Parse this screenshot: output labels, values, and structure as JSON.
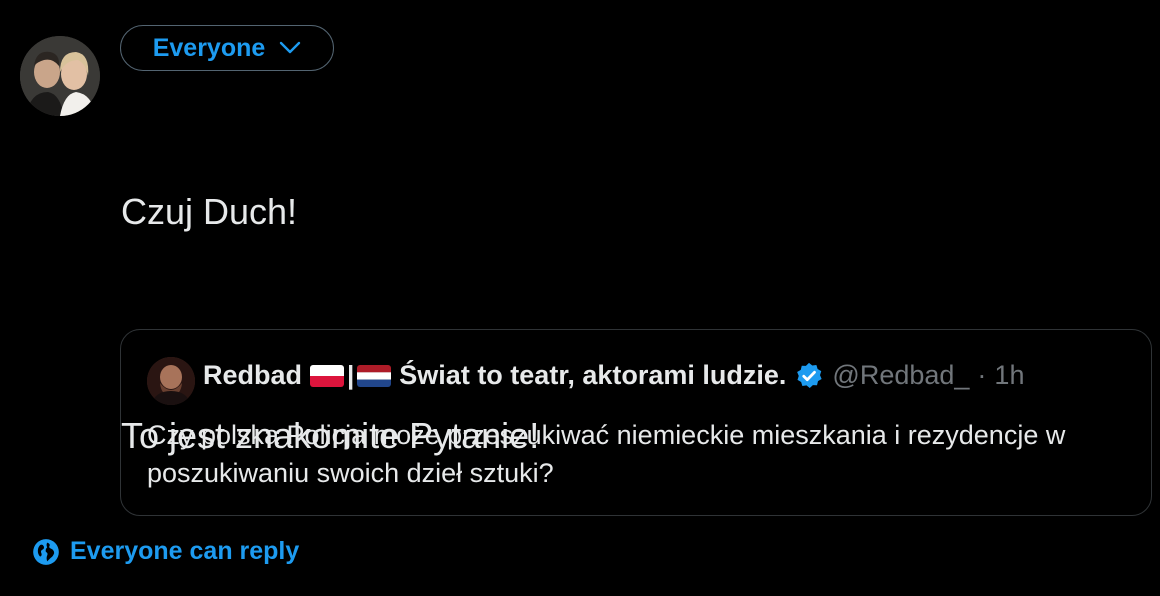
{
  "composer": {
    "audience_label": "Everyone",
    "text_line1": "Czuj Duch!",
    "text_line2": "To jest znakomite Pytanie!"
  },
  "quoted_tweet": {
    "author_name": "Redbad",
    "author_tagline": "Świat to teatr, aktorami ludzie.",
    "handle": "@Redbad_",
    "separator": "·",
    "time": "1h",
    "body": "Czy polska Policja może przeszukiwać niemieckie mieszkania i rezydencje w poszukiwaniu swoich dzieł sztuki?",
    "flags": [
      "poland-flag",
      "netherlands-flag"
    ],
    "flag_separator": "|"
  },
  "reply_settings": {
    "label": "Everyone can reply"
  },
  "colors": {
    "background": "#000000",
    "accent": "#1d9bf0",
    "text": "#e7e9ea",
    "muted": "#71767b",
    "border": "#2f3336"
  }
}
